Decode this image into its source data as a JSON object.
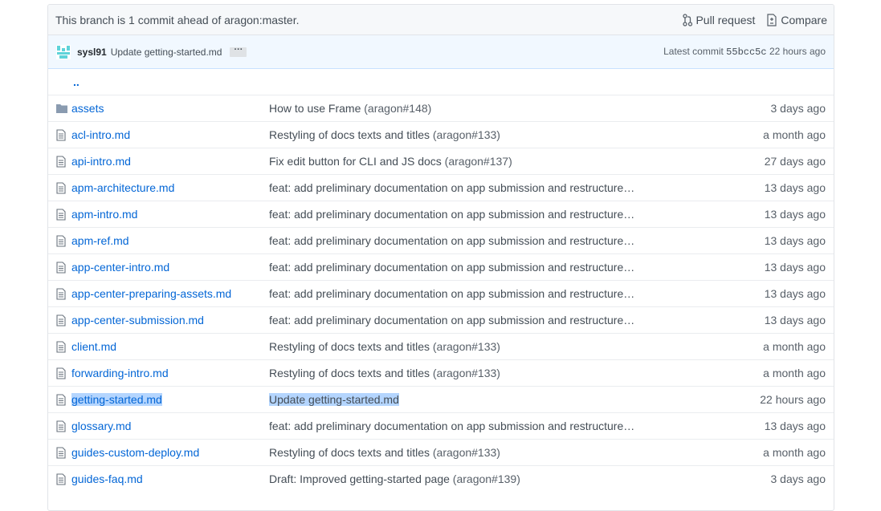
{
  "branch_bar": {
    "message": "This branch is 1 commit ahead of aragon:master.",
    "pull_request_label": "Pull request",
    "compare_label": "Compare"
  },
  "commit_bar": {
    "author": "sysl91",
    "message": "Update getting-started.md",
    "ellipsis": "···",
    "latest_prefix": "Latest commit",
    "sha": "55bcc5c",
    "age": "22 hours ago"
  },
  "up_link": "..",
  "files": [
    {
      "name": "assets",
      "type": "folder",
      "msg": "How to use Frame",
      "ref": "(aragon#148)",
      "age": "3 days ago"
    },
    {
      "name": "acl-intro.md",
      "type": "file",
      "msg": "Restyling of docs texts and titles",
      "ref": "(aragon#133)",
      "age": "a month ago"
    },
    {
      "name": "api-intro.md",
      "type": "file",
      "msg": "Fix edit button for CLI and JS docs",
      "ref": "(aragon#137)",
      "age": "27 days ago"
    },
    {
      "name": "apm-architecture.md",
      "type": "file",
      "msg": "feat: add preliminary documentation on app submission and restructure…",
      "ref": "",
      "age": "13 days ago"
    },
    {
      "name": "apm-intro.md",
      "type": "file",
      "msg": "feat: add preliminary documentation on app submission and restructure…",
      "ref": "",
      "age": "13 days ago"
    },
    {
      "name": "apm-ref.md",
      "type": "file",
      "msg": "feat: add preliminary documentation on app submission and restructure…",
      "ref": "",
      "age": "13 days ago"
    },
    {
      "name": "app-center-intro.md",
      "type": "file",
      "msg": "feat: add preliminary documentation on app submission and restructure…",
      "ref": "",
      "age": "13 days ago"
    },
    {
      "name": "app-center-preparing-assets.md",
      "type": "file",
      "msg": "feat: add preliminary documentation on app submission and restructure…",
      "ref": "",
      "age": "13 days ago"
    },
    {
      "name": "app-center-submission.md",
      "type": "file",
      "msg": "feat: add preliminary documentation on app submission and restructure…",
      "ref": "",
      "age": "13 days ago"
    },
    {
      "name": "client.md",
      "type": "file",
      "msg": "Restyling of docs texts and titles",
      "ref": "(aragon#133)",
      "age": "a month ago"
    },
    {
      "name": "forwarding-intro.md",
      "type": "file",
      "msg": "Restyling of docs texts and titles",
      "ref": "(aragon#133)",
      "age": "a month ago"
    },
    {
      "name": "getting-started.md",
      "type": "file",
      "msg": "Update getting-started.md",
      "ref": "",
      "age": "22 hours ago",
      "selected": true
    },
    {
      "name": "glossary.md",
      "type": "file",
      "msg": "feat: add preliminary documentation on app submission and restructure…",
      "ref": "",
      "age": "13 days ago"
    },
    {
      "name": "guides-custom-deploy.md",
      "type": "file",
      "msg": "Restyling of docs texts and titles",
      "ref": "(aragon#133)",
      "age": "a month ago"
    },
    {
      "name": "guides-faq.md",
      "type": "file",
      "msg": "Draft: Improved getting-started page",
      "ref": "(aragon#139)",
      "age": "3 days ago"
    }
  ]
}
